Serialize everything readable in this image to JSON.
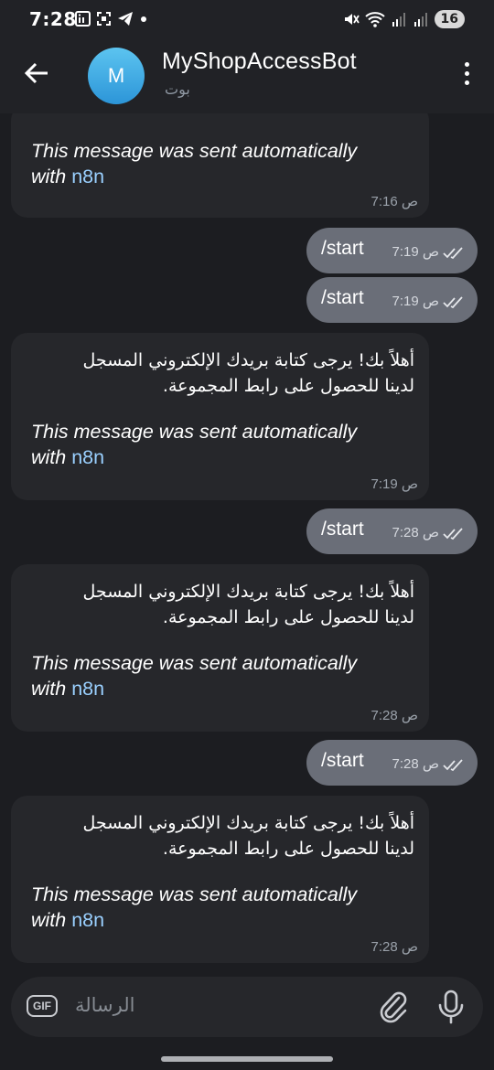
{
  "status_bar": {
    "time": "7:28",
    "battery": "16"
  },
  "header": {
    "avatar_letter": "M",
    "title": "MyShopAccessBot",
    "subtitle": "بوت"
  },
  "messages": [
    {
      "type": "in",
      "auto_line1": "This message was sent automatically",
      "auto_with": "with ",
      "auto_link": "n8n",
      "time": "7:16 ص"
    },
    {
      "type": "out",
      "text": "/start",
      "time": "7:19 ص"
    },
    {
      "type": "out",
      "text": "/start",
      "time": "7:19 ص"
    },
    {
      "type": "in",
      "arabic_line1": "أهلاً بك! يرجى كتابة بريدك الإلكتروني المسجل",
      "arabic_line2": "لدينا للحصول على رابط المجموعة.",
      "auto_line1": "This message was sent automatically",
      "auto_with": "with ",
      "auto_link": "n8n",
      "time": "7:19 ص"
    },
    {
      "type": "out",
      "text": "/start",
      "time": "7:28 ص"
    },
    {
      "type": "in",
      "arabic_line1": "أهلاً بك! يرجى كتابة بريدك الإلكتروني المسجل",
      "arabic_line2": "لدينا للحصول على رابط المجموعة.",
      "auto_line1": "This message was sent automatically",
      "auto_with": "with ",
      "auto_link": "n8n",
      "time": "7:28 ص"
    },
    {
      "type": "out",
      "text": "/start",
      "time": "7:28 ص"
    },
    {
      "type": "in",
      "arabic_line1": "أهلاً بك! يرجى كتابة بريدك الإلكتروني المسجل",
      "arabic_line2": "لدينا للحصول على رابط المجموعة.",
      "auto_line1": "This message was sent automatically",
      "auto_with": "with ",
      "auto_link": "n8n",
      "time": "7:28 ص"
    }
  ],
  "input": {
    "gif_label": "GIF",
    "placeholder": "الرسالة"
  },
  "icons": [
    "back-arrow-icon",
    "more-vertical-icon",
    "gif-icon",
    "attach-icon",
    "microphone-icon",
    "double-check-icon"
  ],
  "colors": {
    "background": "#1c1d21",
    "incoming_bubble": "#26272b",
    "outgoing_bubble": "#6a6e78",
    "link": "#9ad0ff",
    "avatar": "#2c95d8"
  }
}
